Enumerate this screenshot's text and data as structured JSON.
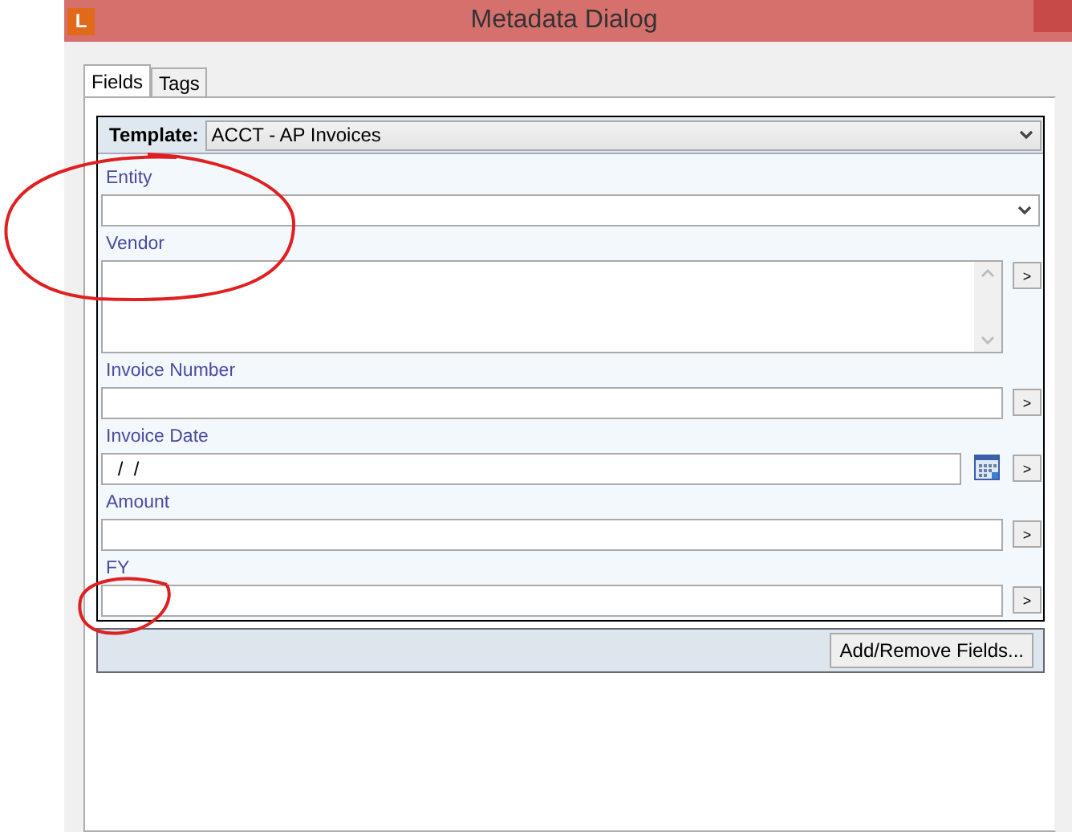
{
  "window": {
    "title": "Metadata Dialog",
    "logo": "L"
  },
  "tabs": [
    {
      "label": "Fields",
      "selected": true
    },
    {
      "label": "Tags",
      "selected": false
    }
  ],
  "template": {
    "label": "Template:",
    "value": "ACCT - AP Invoices"
  },
  "fields": [
    {
      "label": "Entity",
      "kind": "dropdown"
    },
    {
      "label": "Vendor",
      "kind": "multiline",
      "more": ">"
    },
    {
      "label": "Invoice Number",
      "kind": "text",
      "more": ">"
    },
    {
      "label": "Invoice Date",
      "kind": "date",
      "value": " /  /",
      "more": ">"
    },
    {
      "label": "Amount",
      "kind": "text",
      "more": ">"
    },
    {
      "label": "FY",
      "kind": "text",
      "more": ">"
    }
  ],
  "footer": {
    "button": "Add/Remove Fields..."
  }
}
